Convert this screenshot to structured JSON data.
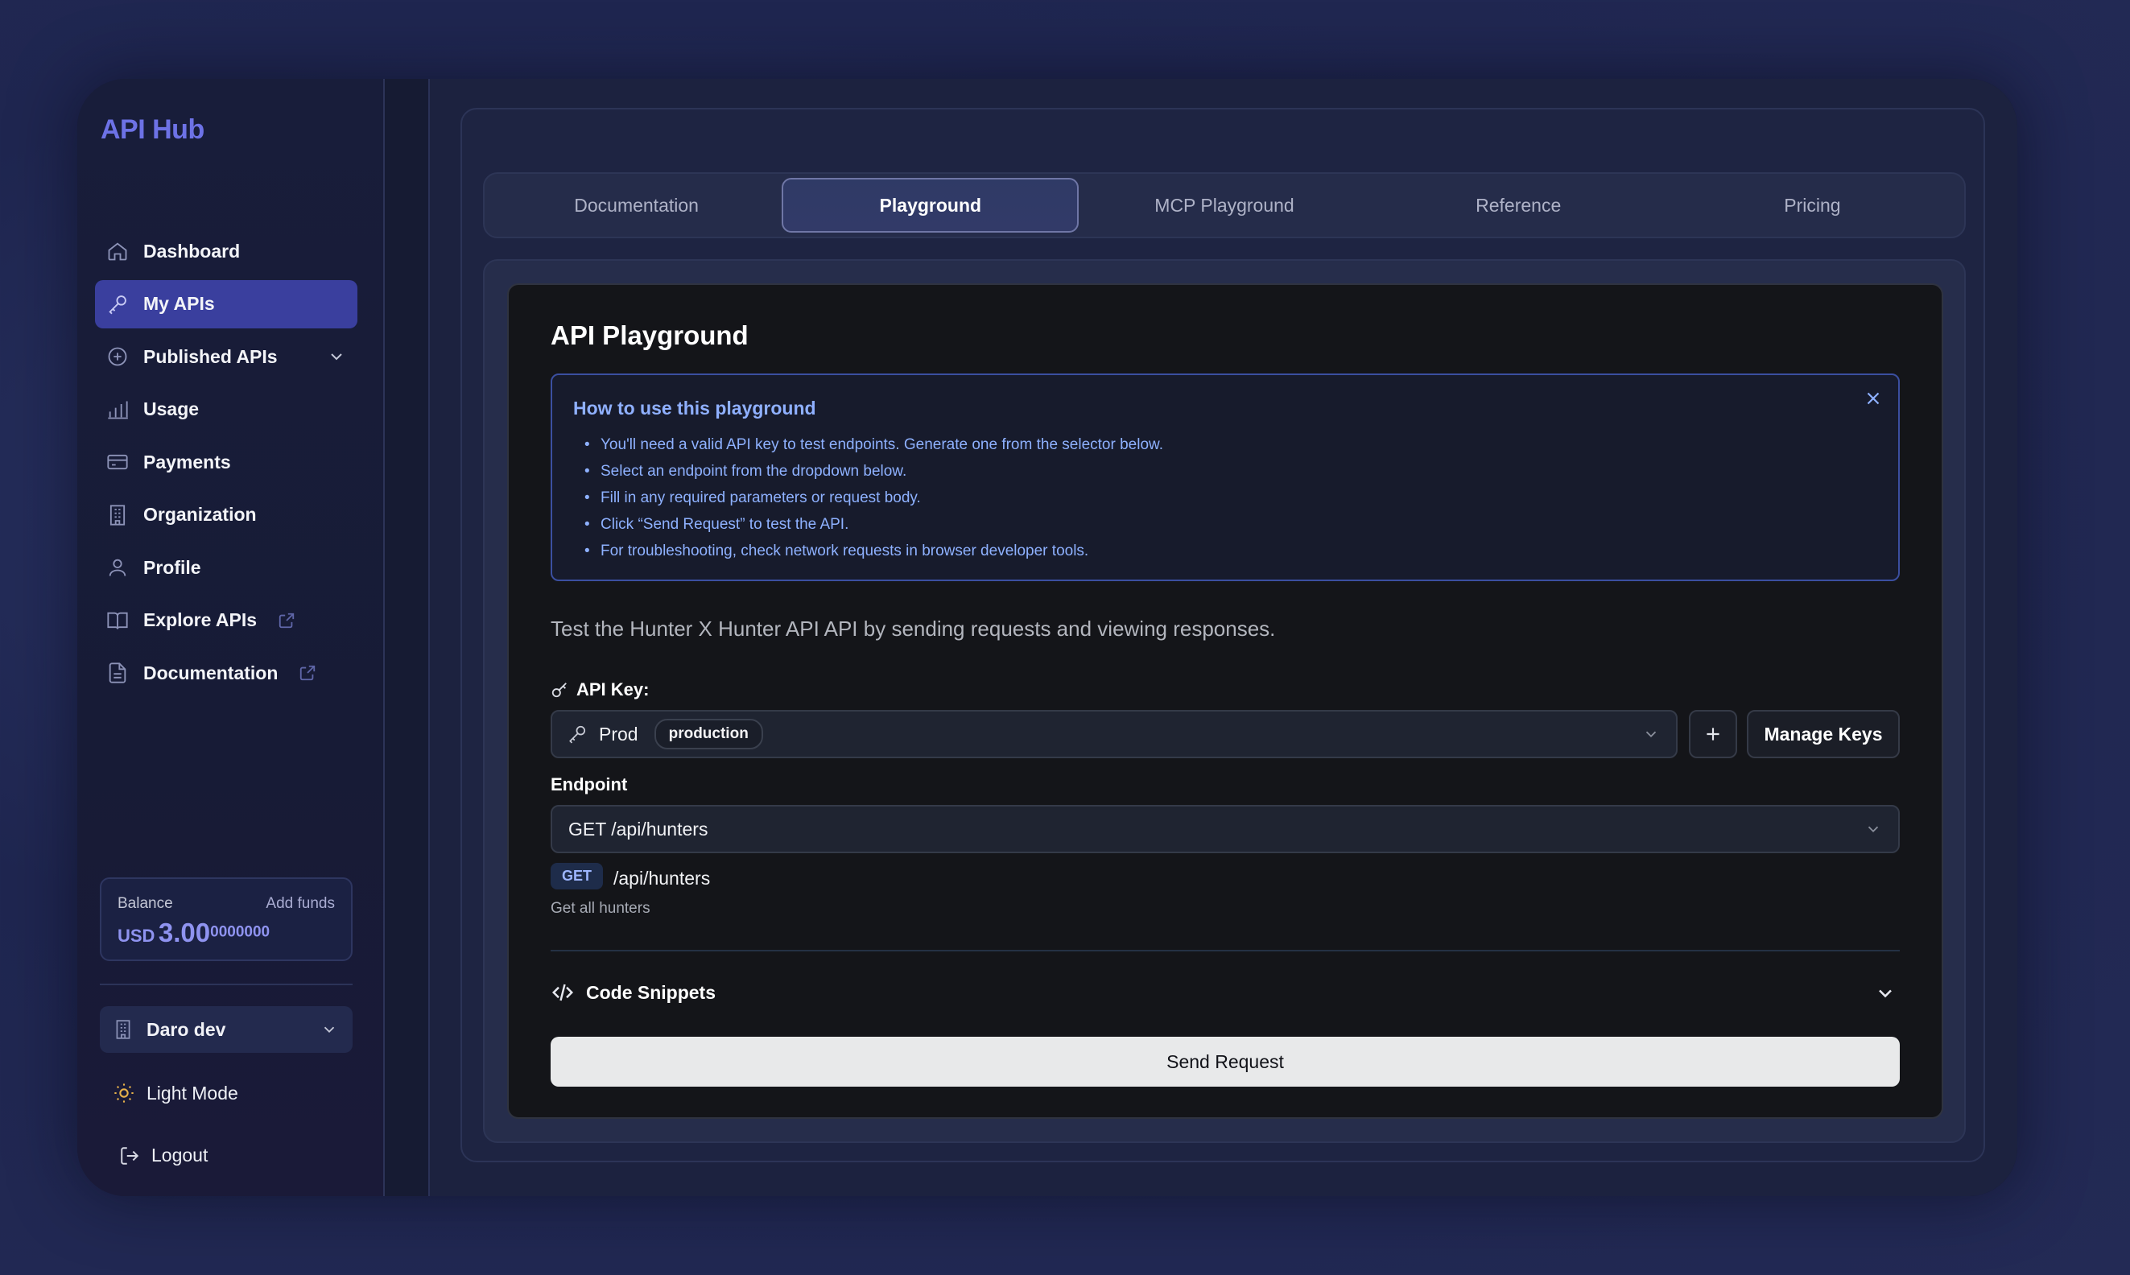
{
  "sidebar": {
    "brand": "API Hub",
    "items": [
      {
        "label": "Dashboard",
        "icon": "home-icon"
      },
      {
        "label": "My APIs",
        "icon": "key-icon",
        "active": true
      },
      {
        "label": "Published APIs",
        "icon": "plus-circle-icon"
      },
      {
        "label": "Usage",
        "icon": "bar-chart-icon"
      },
      {
        "label": "Payments",
        "icon": "credit-card-icon"
      },
      {
        "label": "Organization",
        "icon": "building-icon"
      },
      {
        "label": "Profile",
        "icon": "user-icon"
      },
      {
        "label": "Explore APIs",
        "icon": "book-icon"
      },
      {
        "label": "Documentation",
        "icon": "file-icon"
      }
    ],
    "balance": {
      "label": "Balance",
      "add_funds": "Add funds",
      "currency": "USD",
      "amount": "3.00",
      "decimals": "0000000"
    },
    "organization": "Daro dev",
    "mode_toggle": "Light Mode",
    "logout": "Logout"
  },
  "tabs": [
    {
      "label": "Documentation"
    },
    {
      "label": "Playground",
      "active": true
    },
    {
      "label": "MCP Playground"
    },
    {
      "label": "Reference"
    },
    {
      "label": "Pricing"
    }
  ],
  "playground": {
    "title": "API Playground",
    "howto": {
      "title": "How to use this playground",
      "steps": [
        "You'll need a valid API key to test endpoints. Generate one from the selector below.",
        "Select an endpoint from the dropdown below.",
        "Fill in any required parameters or request body.",
        "Click “Send Request” to test the API.",
        "For troubleshooting, check network requests in browser developer tools."
      ]
    },
    "description": "Test the Hunter X Hunter API API by sending requests and viewing responses.",
    "api_key_label": "API Key:",
    "api_key_selected": "Prod",
    "api_key_env": "production",
    "add_key": "+",
    "manage_keys": "Manage Keys",
    "endpoint_label": "Endpoint",
    "endpoint_selected": "GET /api/hunters",
    "endpoint_method": "GET",
    "endpoint_path": "/api/hunters",
    "endpoint_description": "Get all hunters",
    "code_snippets": "Code Snippets",
    "send_request": "Send Request"
  },
  "colors": {
    "accent": "#3a3f9e",
    "brand": "#6d72e6",
    "info": "#8eb1ff"
  }
}
